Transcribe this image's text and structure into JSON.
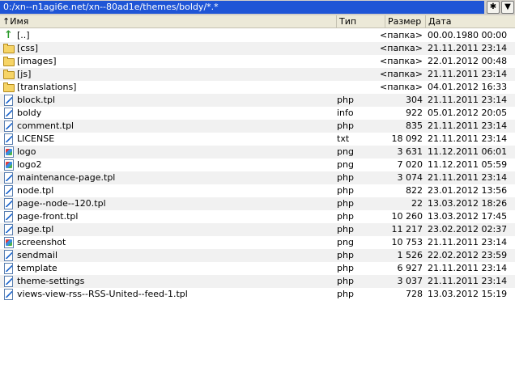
{
  "path_bar": {
    "path": "0:/xn--n1agi6e.net/xn--80ad1e/themes/boldy/*.*",
    "star_icon": "star-icon",
    "dropdown_icon": "dropdown-arrow-icon"
  },
  "columns": {
    "name": "↑Имя",
    "type": "Тип",
    "size": "Размер",
    "date": "Дата"
  },
  "rows": [
    {
      "icon": "up-arrow-icon",
      "name": "[..]",
      "type": "",
      "size": "<папка>",
      "date": "00.00.1980 00:00"
    },
    {
      "icon": "folder-icon",
      "name": "[css]",
      "type": "",
      "size": "<папка>",
      "date": "21.11.2011 23:14"
    },
    {
      "icon": "folder-icon",
      "name": "[images]",
      "type": "",
      "size": "<папка>",
      "date": "22.01.2012 00:48"
    },
    {
      "icon": "folder-icon",
      "name": "[js]",
      "type": "",
      "size": "<папка>",
      "date": "21.11.2011 23:14"
    },
    {
      "icon": "folder-icon",
      "name": "[translations]",
      "type": "",
      "size": "<папка>",
      "date": "04.01.2012 16:33"
    },
    {
      "icon": "file-icon",
      "name": "block.tpl",
      "type": "php",
      "size": "304",
      "date": "21.11.2011 23:14"
    },
    {
      "icon": "file-icon",
      "name": "boldy",
      "type": "info",
      "size": "922",
      "date": "05.01.2012 20:05"
    },
    {
      "icon": "file-icon",
      "name": "comment.tpl",
      "type": "php",
      "size": "835",
      "date": "21.11.2011 23:14"
    },
    {
      "icon": "file-icon",
      "name": "LICENSE",
      "type": "txt",
      "size": "18 092",
      "date": "21.11.2011 23:14"
    },
    {
      "icon": "image-icon",
      "name": "logo",
      "type": "png",
      "size": "3 631",
      "date": "11.12.2011 06:01"
    },
    {
      "icon": "image-icon",
      "name": "logo2",
      "type": "png",
      "size": "7 020",
      "date": "11.12.2011 05:59"
    },
    {
      "icon": "file-icon",
      "name": "maintenance-page.tpl",
      "type": "php",
      "size": "3 074",
      "date": "21.11.2011 23:14"
    },
    {
      "icon": "file-icon",
      "name": "node.tpl",
      "type": "php",
      "size": "822",
      "date": "23.01.2012 13:56"
    },
    {
      "icon": "file-icon",
      "name": "page--node--120.tpl",
      "type": "php",
      "size": "22",
      "date": "13.03.2012 18:26"
    },
    {
      "icon": "file-icon",
      "name": "page-front.tpl",
      "type": "php",
      "size": "10 260",
      "date": "13.03.2012 17:45"
    },
    {
      "icon": "file-icon",
      "name": "page.tpl",
      "type": "php",
      "size": "11 217",
      "date": "23.02.2012 02:37"
    },
    {
      "icon": "image-icon",
      "name": "screenshot",
      "type": "png",
      "size": "10 753",
      "date": "21.11.2011 23:14"
    },
    {
      "icon": "file-icon",
      "name": "sendmail",
      "type": "php",
      "size": "1 526",
      "date": "22.02.2012 23:59"
    },
    {
      "icon": "file-icon",
      "name": "template",
      "type": "php",
      "size": "6 927",
      "date": "21.11.2011 23:14"
    },
    {
      "icon": "file-icon",
      "name": "theme-settings",
      "type": "php",
      "size": "3 037",
      "date": "21.11.2011 23:14"
    },
    {
      "icon": "file-icon",
      "name": "views-view-rss--RSS-United--feed-1.tpl",
      "type": "php",
      "size": "728",
      "date": "13.03.2012 15:19"
    }
  ]
}
